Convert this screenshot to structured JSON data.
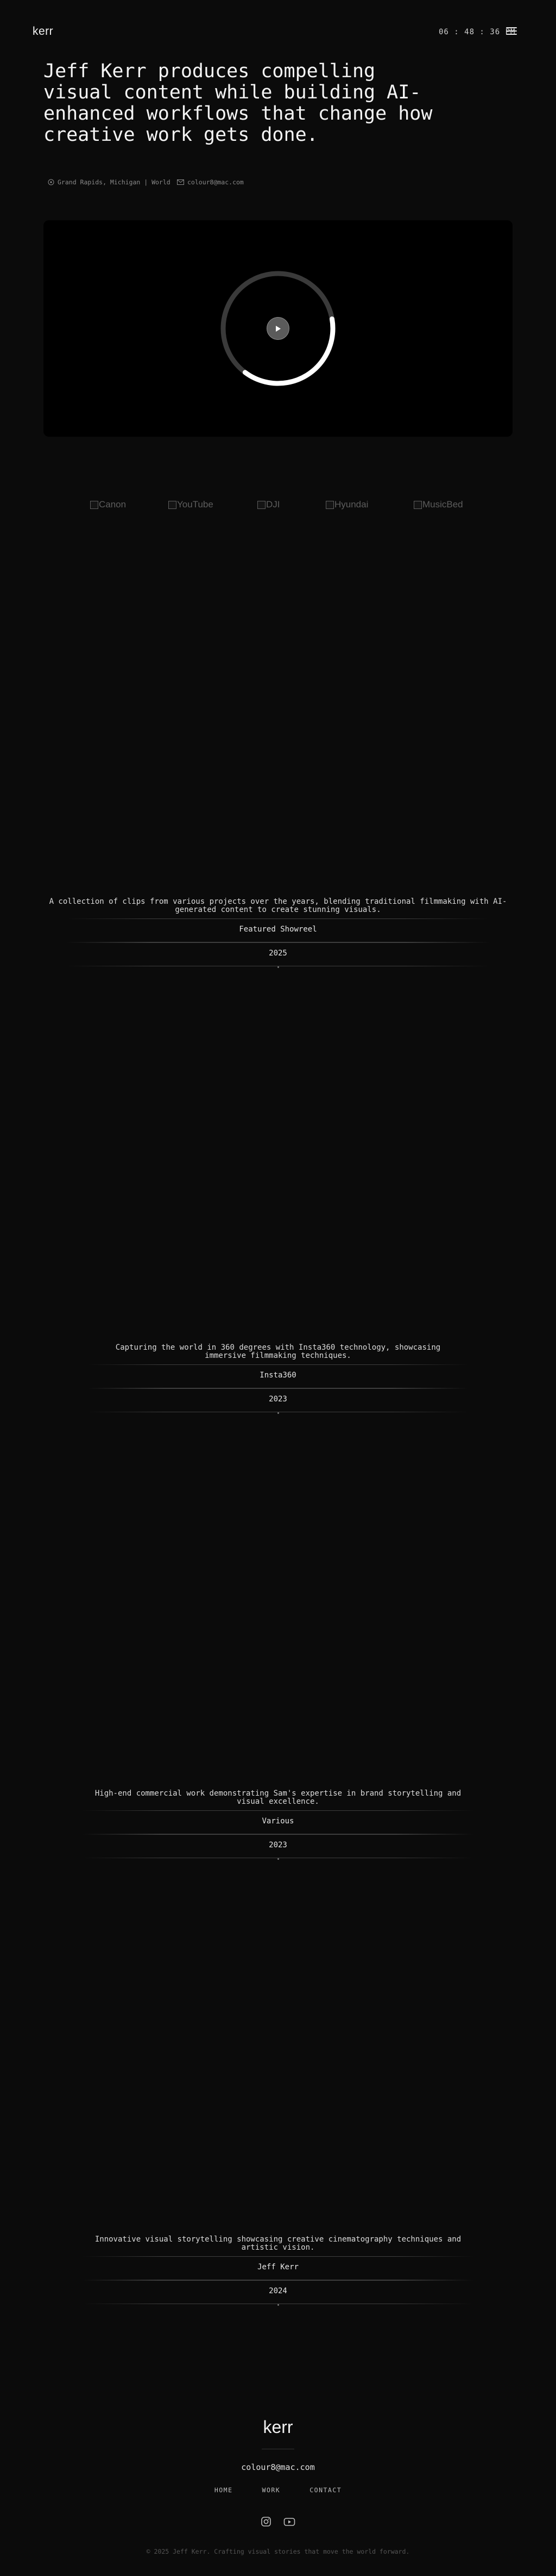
{
  "header": {
    "logo": "kerr",
    "clock": "06 : 48 : 36 PM"
  },
  "hero": {
    "title": "Jeff Kerr produces compelling visual content while building AI-enhanced workflows that change how creative work gets done.",
    "location": "Grand Rapids, Michigan | World",
    "email": "colour8@mac.com"
  },
  "video": {
    "progress": 0.38
  },
  "clients": [
    "Canon",
    "YouTube",
    "DJI",
    "Hyundai",
    "MusicBed"
  ],
  "projects": [
    {
      "description": "A collection of clips from various projects over the years, blending traditional filmmaking with AI-generated content to create stunning visuals.",
      "client": "Featured Showreel",
      "year": "2025"
    },
    {
      "description": "Capturing the world in 360 degrees with Insta360 technology, showcasing immersive filmmaking techniques.",
      "client": "Insta360",
      "year": "2023"
    },
    {
      "description": "High-end commercial work demonstrating Sam's expertise in brand storytelling and visual excellence.",
      "client": "Various",
      "year": "2023"
    },
    {
      "description": "Innovative visual storytelling showcasing creative cinematography techniques and artistic vision.",
      "client": "Jeff Kerr",
      "year": "2024"
    }
  ],
  "footer": {
    "logo": "kerr",
    "email": "colour8@mac.com",
    "nav": [
      "HOME",
      "WORK",
      "CONTACT"
    ],
    "copyright": "2025 Jeff Kerr. Crafting visual stories that move the world forward."
  }
}
